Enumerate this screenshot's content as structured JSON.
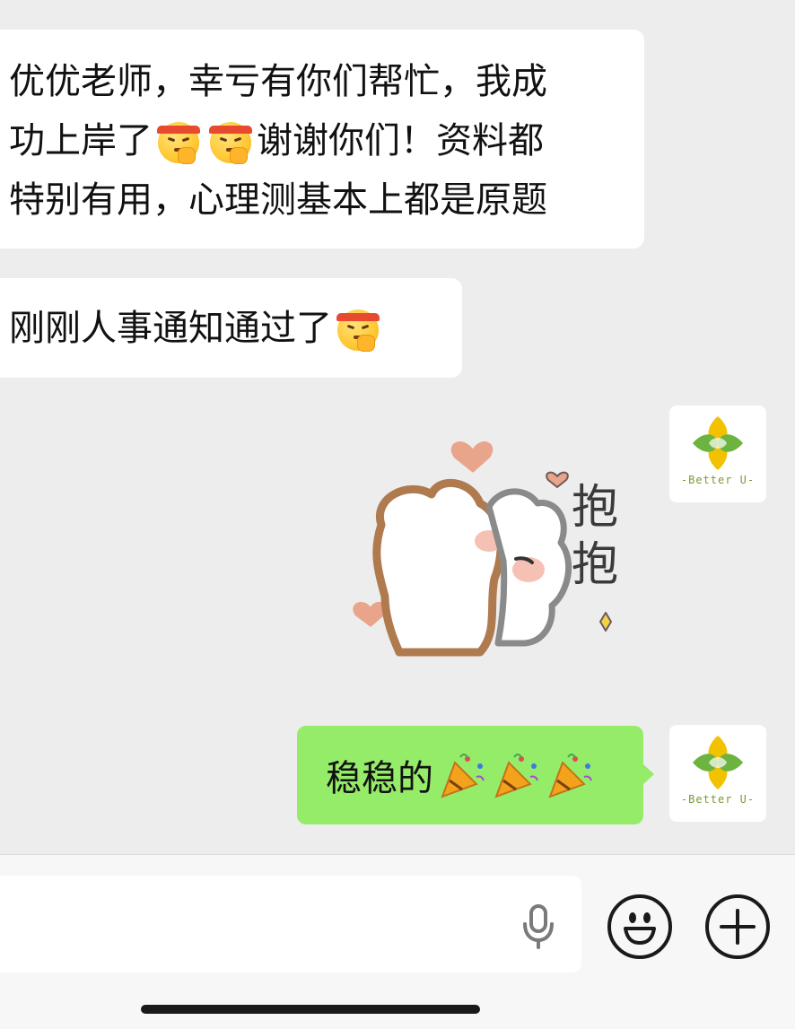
{
  "chat": {
    "messages": [
      {
        "side": "incoming",
        "lines": [
          {
            "text": "优优老师，幸亏有你们帮忙，我成"
          },
          {
            "before": "功上岸了",
            "emoji_count": 2,
            "emoji": "headband-face-emoji",
            "after": "谢谢你们！资料都"
          },
          {
            "text": "特别有用，心理测基本上都是原题"
          }
        ]
      },
      {
        "side": "incoming",
        "text": "刚刚人事通知通过了",
        "emoji": "headband-face-emoji"
      },
      {
        "side": "outgoing",
        "type": "sticker",
        "sticker_text": "抱抱",
        "sticker": "hugging-bears-sticker"
      },
      {
        "side": "outgoing",
        "text": "稳稳的",
        "emoji": "party-popper-emoji",
        "emoji_count": 3
      }
    ],
    "avatar": {
      "brand_text": "-Better U-",
      "colors": {
        "green": "#6cb33f",
        "yellow": "#f2c200"
      }
    }
  },
  "input_bar": {
    "icons": [
      "microphone-icon",
      "emoji-icon",
      "plus-icon"
    ]
  },
  "colors": {
    "background": "#ededed",
    "incoming_bubble": "#ffffff",
    "outgoing_bubble": "#95ec69"
  }
}
